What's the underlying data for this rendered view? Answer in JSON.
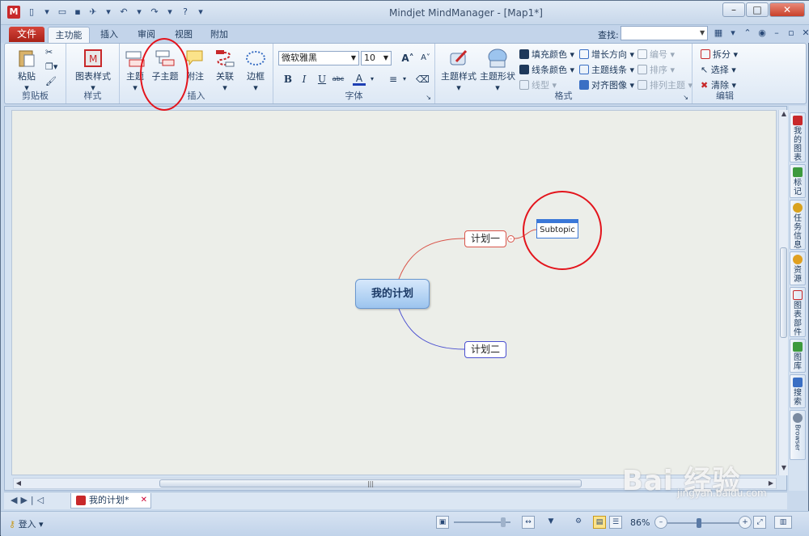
{
  "titlebar": {
    "title": "Mindjet MindManager - [Map1*]",
    "app_letter": "M"
  },
  "tabs": {
    "file": "文件",
    "home": "主功能",
    "insert": "插入",
    "review": "审阅",
    "view": "视图",
    "addins": "附加"
  },
  "search": {
    "label": "查找:",
    "value": ""
  },
  "ribbon": {
    "clipboard": {
      "label": "剪贴板",
      "paste": "粘贴"
    },
    "style": {
      "label": "样式",
      "map_style": "图表样式"
    },
    "insert": {
      "label": "插入",
      "topic": "主题",
      "subtopic": "子主题",
      "callout": "附注",
      "relationship": "关联",
      "boundary": "边框"
    },
    "font": {
      "label": "字体",
      "family": "微软雅黑",
      "size": "10",
      "bold": "B",
      "italic": "I",
      "underline": "U",
      "strike": "abc",
      "color_a": "A"
    },
    "format": {
      "label": "格式",
      "topic_style": "主题样式",
      "topic_shape": "主题形状",
      "fill_color": "填充颜色",
      "line_color": "线条颜色",
      "line_shape": "线型",
      "growth_direction": "增长方向",
      "topic_lines": "主题线条",
      "align_images": "对齐图像",
      "numbering": "编号",
      "sort": "排序",
      "arrange_topics": "排列主题"
    },
    "editing": {
      "label": "编辑",
      "split": "拆分",
      "select": "选择",
      "clear": "清除"
    }
  },
  "map": {
    "central_topic": "我的计划",
    "topic1": "计划一",
    "topic2": "计划二",
    "subtopic": "Subtopic",
    "colors": {
      "branch1": "#d9544a",
      "branch2": "#4a4fd0",
      "subtopic_border": "#3b78d8"
    }
  },
  "right_panel": [
    {
      "label": "我的图表",
      "icon": "my-maps-icon",
      "color": "#c8282a"
    },
    {
      "label": "标记",
      "icon": "markers-icon",
      "color": "#3d9a3d"
    },
    {
      "label": "任务信息",
      "icon": "task-info-icon",
      "color": "#d9a21e"
    },
    {
      "label": "资源",
      "icon": "resources-icon",
      "color": "#e0a020"
    },
    {
      "label": "图表部件",
      "icon": "map-parts-icon",
      "color": "#c8282a"
    },
    {
      "label": "图库",
      "icon": "library-icon",
      "color": "#3d9a3d"
    },
    {
      "label": "搜索",
      "icon": "search-panel-icon",
      "color": "#3a6fc4"
    },
    {
      "label": "Browser",
      "icon": "browser-icon",
      "color": "#7a8aa0"
    }
  ],
  "doc_tab": {
    "name": "我的计划*"
  },
  "status": {
    "login": "登入",
    "zoom": "86%"
  },
  "watermark": {
    "main": "Bai 经验",
    "sub": "jingyan.baidu.com"
  }
}
